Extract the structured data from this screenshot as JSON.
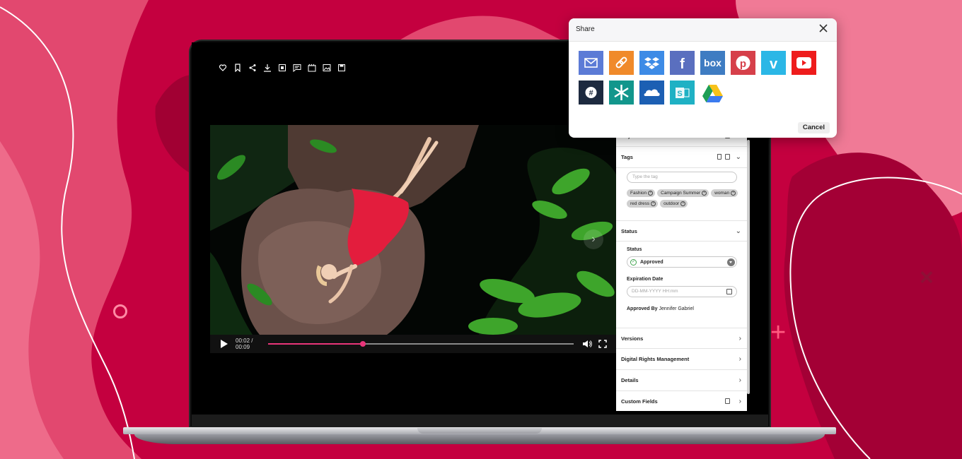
{
  "colors": {
    "background": "#c4003f",
    "accent": "#e8357a",
    "status_approved": "#3fa34d"
  },
  "toolbar": {
    "icons": [
      "add-to-collection-icon",
      "bookmark-icon",
      "share-icon",
      "download-icon",
      "crop-icon",
      "comment-icon",
      "video-clip-icon",
      "image-icon",
      "save-icon"
    ]
  },
  "player": {
    "time": "00:02 / 00:09",
    "progress": 0.31
  },
  "panel": {
    "keywords_label": "Keywords",
    "tags_section": {
      "title": "Tags",
      "placeholder": "Type the tag",
      "tags": [
        "Fashion",
        "Campaign Summer",
        "woman",
        "red dress",
        "outdoor"
      ]
    },
    "status_section": {
      "title": "Status",
      "status_label": "Status",
      "status_value": "Approved",
      "expiration_label": "Expiration Date",
      "expiration_placeholder": "DD-MM-YYYY HH:mm",
      "approved_by_label": "Approved By",
      "approved_by_value": "Jennifer Gabriel"
    },
    "versions": "Versions",
    "drm": "Digital Rights Management",
    "details": "Details",
    "custom_fields": "Custom Fields"
  },
  "share_dialog": {
    "title": "Share",
    "cancel": "Cancel",
    "services": [
      {
        "name": "email",
        "color": "#5c7bd6"
      },
      {
        "name": "link",
        "color": "#f08a2a"
      },
      {
        "name": "dropbox",
        "color": "#3d8be6"
      },
      {
        "name": "facebook",
        "color": "#5a6fbf"
      },
      {
        "name": "box",
        "color": "#3e7cc2"
      },
      {
        "name": "pinterest",
        "color": "#d6404a"
      },
      {
        "name": "vimeo",
        "color": "#2bb7e6"
      },
      {
        "name": "youtube",
        "color": "#ee1c1c"
      },
      {
        "name": "slack",
        "color": "#1d2a3f"
      },
      {
        "name": "zapier-like",
        "color": "#12968c"
      },
      {
        "name": "onedrive",
        "color": "#1c5fb3"
      },
      {
        "name": "sharepoint",
        "color": "#1fb1c4"
      },
      {
        "name": "google-drive",
        "color": "#ffffff"
      }
    ]
  }
}
